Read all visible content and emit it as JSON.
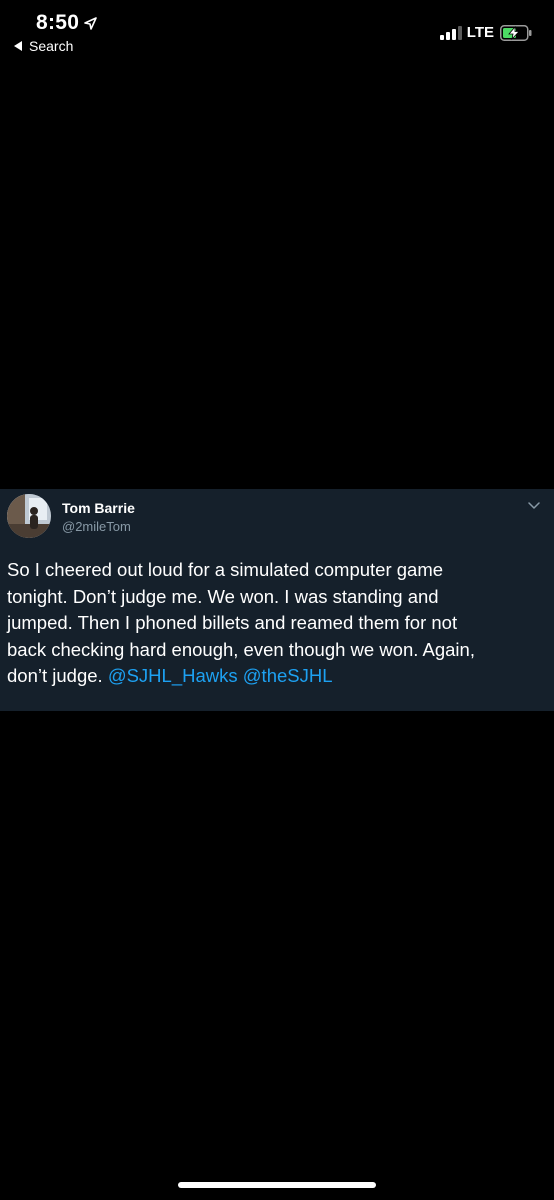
{
  "status_bar": {
    "time": "8:50",
    "back_label": "Search",
    "network": "LTE"
  },
  "tweet": {
    "author": {
      "name": "Tom Barrie",
      "handle": "@2mileTom"
    },
    "text_lines": [
      "So I cheered out loud for a simulated computer game",
      "tonight.  Don’t judge me. We won. I was standing and",
      "jumped. Then I  phoned billets and reamed them for not",
      "back checking hard enough, even though we won. Again,",
      "don’t judge. "
    ],
    "mentions": [
      "@SJHL_Hawks",
      "@theSJHL"
    ]
  },
  "colors": {
    "card_background": "#15202b",
    "mention": "#1da1f2",
    "handle": "#8899a6"
  },
  "icons": {
    "location": "location-arrow-icon",
    "back": "back-caret-icon",
    "signal": "signal-bars-icon",
    "battery": "battery-charging-icon",
    "menu": "chevron-down-icon"
  }
}
